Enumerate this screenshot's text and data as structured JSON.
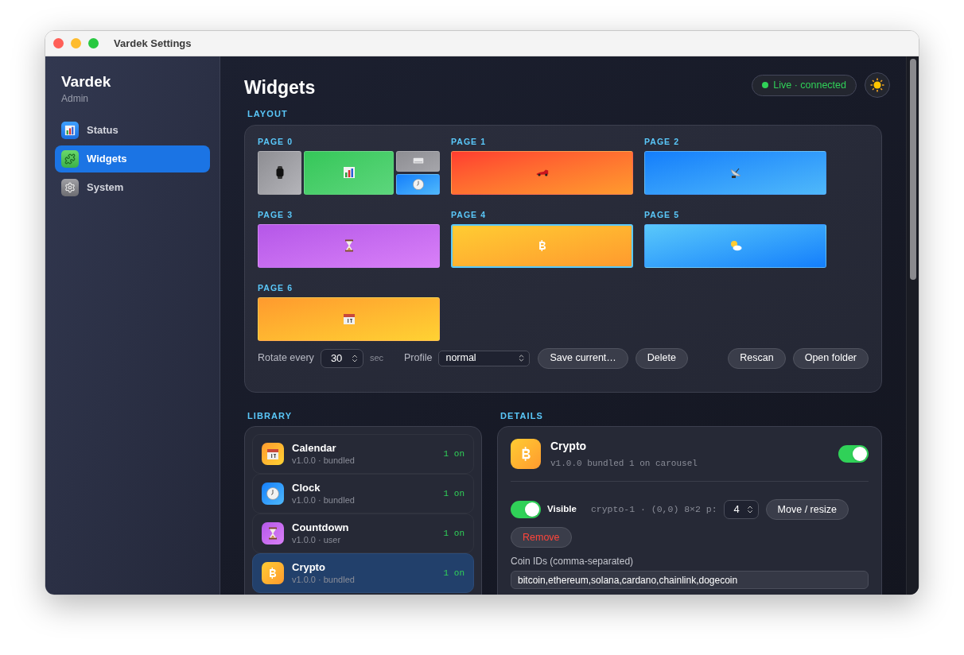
{
  "window": {
    "title": "Vardek Settings"
  },
  "sidebar": {
    "app_name": "Vardek",
    "role": "Admin",
    "items": [
      {
        "label": "Status",
        "kind": "status",
        "selected": false
      },
      {
        "label": "Widgets",
        "kind": "widgets",
        "selected": true
      },
      {
        "label": "System",
        "kind": "system",
        "selected": false
      }
    ]
  },
  "header": {
    "title": "Widgets",
    "status": "Live · connected"
  },
  "layout": {
    "heading": "LAYOUT",
    "pages": [
      {
        "label": "PAGE 0",
        "tiles": [
          {
            "kind": "watch",
            "selected": false
          },
          {
            "kind": "chart",
            "selected": false
          },
          {
            "kind": "laptop",
            "selected": false
          },
          {
            "kind": "clock",
            "selected": false
          }
        ]
      },
      {
        "label": "PAGE 1",
        "tiles": [
          {
            "kind": "car",
            "selected": false
          }
        ]
      },
      {
        "label": "PAGE 2",
        "tiles": [
          {
            "kind": "dish",
            "selected": false
          }
        ]
      },
      {
        "label": "PAGE 3",
        "tiles": [
          {
            "kind": "hourglass",
            "selected": false
          }
        ]
      },
      {
        "label": "PAGE 4",
        "tiles": [
          {
            "kind": "crypto",
            "selected": true
          }
        ]
      },
      {
        "label": "PAGE 5",
        "tiles": [
          {
            "kind": "weather",
            "selected": false
          }
        ]
      },
      {
        "label": "PAGE 6",
        "tiles": [
          {
            "kind": "calendar",
            "selected": false
          }
        ]
      }
    ],
    "rotate": {
      "label": "Rotate every",
      "value": "30",
      "unit": "sec"
    },
    "profile": {
      "label": "Profile",
      "value": "normal"
    },
    "buttons": [
      "Save current…",
      "Delete"
    ],
    "right_buttons": [
      "Rescan",
      "Open folder"
    ]
  },
  "library": {
    "heading": "LIBRARY",
    "items": [
      {
        "name": "Calendar",
        "meta": "v1.0.0 · bundled",
        "count": "1 on",
        "kind": "calendar",
        "selected": false
      },
      {
        "name": "Clock",
        "meta": "v1.0.0 · bundled",
        "count": "1 on",
        "kind": "clock",
        "selected": false
      },
      {
        "name": "Countdown",
        "meta": "v1.0.0 · user",
        "count": "1 on",
        "kind": "hourglass",
        "selected": false
      },
      {
        "name": "Crypto",
        "meta": "v1.0.0 · bundled",
        "count": "1 on",
        "kind": "crypto",
        "selected": true
      }
    ]
  },
  "details": {
    "heading": "DETAILS",
    "name": "Crypto",
    "kind": "crypto",
    "meta": "v1.0.0 bundled 1 on carousel",
    "enabled": true,
    "instance": {
      "visible": true,
      "visible_label": "Visible",
      "info": "crypto-1 · (0,0) 8×2 p:",
      "priority": "4",
      "move_button": "Move / resize",
      "remove_button": "Remove"
    },
    "field": {
      "label": "Coin IDs (comma-separated)",
      "value": "bitcoin,ethereum,solana,cardano,chainlink,dogecoin"
    }
  }
}
